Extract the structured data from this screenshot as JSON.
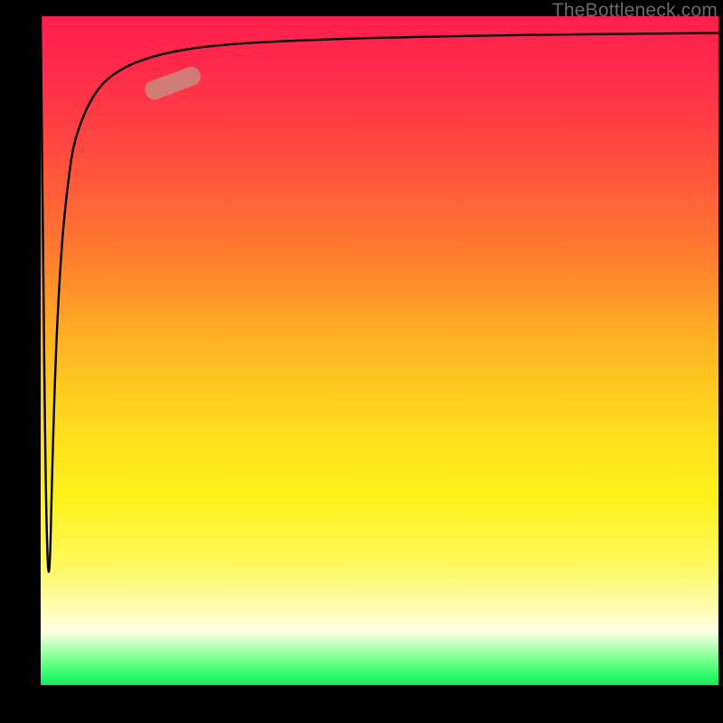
{
  "watermark": "TheBottleneck.com",
  "colors": {
    "curve_stroke": "#000000",
    "marker_fill": "#c98b80",
    "marker_fill_opacity": "0.85",
    "frame_bg": "#000000"
  },
  "chart_data": {
    "type": "line",
    "title": "",
    "xlabel": "",
    "ylabel": "",
    "x": [
      0.0,
      0.01,
      0.02,
      0.03,
      0.04,
      0.05,
      0.08,
      0.12,
      0.18,
      0.25,
      0.35,
      0.5,
      0.7,
      1.0
    ],
    "values": [
      0.0,
      0.98,
      0.55,
      0.35,
      0.25,
      0.18,
      0.11,
      0.076,
      0.055,
      0.044,
      0.037,
      0.032,
      0.028,
      0.025
    ],
    "xlim": [
      0,
      1
    ],
    "ylim": [
      0,
      1
    ],
    "y_axis_inverted": true,
    "series": [
      {
        "name": "bottleneck-curve",
        "x": [
          0.0,
          0.01,
          0.02,
          0.03,
          0.04,
          0.05,
          0.08,
          0.12,
          0.18,
          0.25,
          0.35,
          0.5,
          0.7,
          1.0
        ],
        "values": [
          0.0,
          0.98,
          0.55,
          0.35,
          0.25,
          0.18,
          0.11,
          0.076,
          0.055,
          0.044,
          0.037,
          0.032,
          0.028,
          0.025
        ]
      }
    ],
    "marker": {
      "x_from": 0.155,
      "y_top_from": 0.115,
      "x_to": 0.235,
      "y_top_to": 0.085,
      "note": "pill-shaped highlight on upper-left bend of curve"
    },
    "annotations": [
      {
        "text": "TheBottleneck.com",
        "position": "top-right"
      }
    ]
  }
}
